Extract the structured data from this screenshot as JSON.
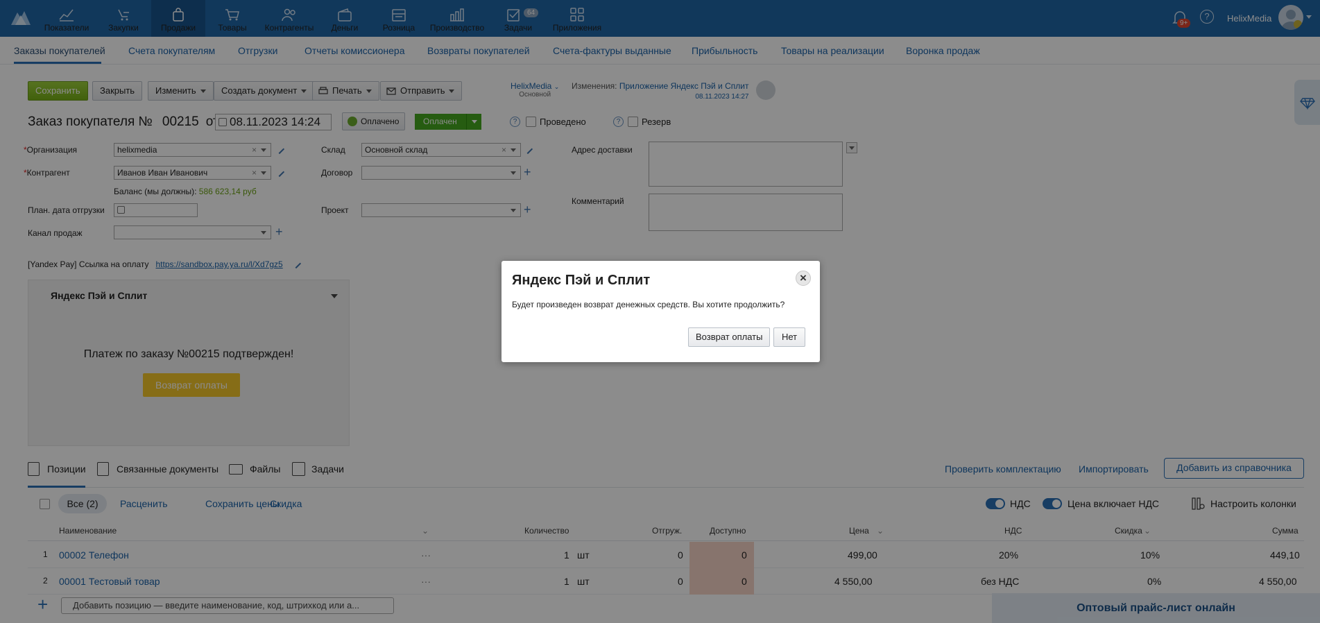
{
  "nav": {
    "items": [
      {
        "label": "Показатели",
        "icon": "chart-line-icon"
      },
      {
        "label": "Закупки",
        "icon": "purchase-icon"
      },
      {
        "label": "Продажи",
        "icon": "bag-icon"
      },
      {
        "label": "Товары",
        "icon": "cart-icon"
      },
      {
        "label": "Контрагенты",
        "icon": "people-icon"
      },
      {
        "label": "Деньги",
        "icon": "wallet-icon"
      },
      {
        "label": "Розница",
        "icon": "cash-register-icon"
      },
      {
        "label": "Производство",
        "icon": "factory-icon"
      },
      {
        "label": "Задачи",
        "icon": "tasks-icon"
      },
      {
        "label": "Приложения",
        "icon": "apps-icon"
      }
    ],
    "tasks_badge": "64",
    "notifications_badge": "9+",
    "username": "HelixMedia",
    "help_label": "?"
  },
  "subnav": {
    "items": [
      "Заказы покупателей",
      "Счета покупателям",
      "Отгрузки",
      "Отчеты комиссионера",
      "Возвраты покупателей",
      "Счета-фактуры выданные",
      "Прибыльность",
      "Товары на реализации",
      "Воронка продаж"
    ]
  },
  "toolbar": {
    "save": "Сохранить",
    "close": "Закрыть",
    "edit": "Изменить",
    "create_doc": "Создать документ",
    "print": "Печать",
    "send": "Отправить",
    "org_name": "HelixMedia",
    "org_sub": "Основной",
    "changes_label": "Изменения:",
    "changes_author": "Приложение Яндекс Пэй и Сплит",
    "changes_date": "08.11.2023 14:27"
  },
  "order": {
    "title": "Заказ покупателя №",
    "number": "00215",
    "from": "от",
    "date": "08.11.2023 14:24",
    "paid_button": "Оплачено",
    "status": "Оплачен",
    "posted_label": "Проведено",
    "reserve_label": "Резерв",
    "question": "?"
  },
  "fields": {
    "org_label": "Организация",
    "org_value": "helixmedia",
    "contractor_label": "Контрагент",
    "contractor_value": "Иванов Иван Иванович",
    "balance_label": "Баланс (мы должны):",
    "balance_value": "586 623,14 руб",
    "ship_date_label": "План. дата отгрузки",
    "channel_label": "Канал продаж",
    "warehouse_label": "Склад",
    "warehouse_value": "Основной склад",
    "contract_label": "Договор",
    "project_label": "Проект",
    "address_label": "Адрес доставки",
    "comment_label": "Комментарий",
    "required_mark": "*",
    "clear_mark": "×"
  },
  "yandex": {
    "link_label": "[Yandex Pay] Ссылка на оплату",
    "link_url": "https://sandbox.pay.ya.ru/l/Xd7gz5",
    "panel_title": "Яндекс Пэй и Сплит",
    "panel_message": "Платеж по заказу №00215 подтвержден!",
    "refund_button": "Возврат оплаты"
  },
  "tabs": {
    "positions": "Позиции",
    "related": "Связанные документы",
    "files": "Файлы",
    "tasks": "Задачи",
    "check": "Проверить комплектацию",
    "import": "Импортировать",
    "add_ref": "Добавить из справочника"
  },
  "filters": {
    "all": "Все (2)",
    "price": "Расценить",
    "save_prices": "Сохранить цены",
    "discount": "Скидка",
    "vat": "НДС",
    "price_incl_vat": "Цена включает НДС",
    "columns": "Настроить колонки"
  },
  "table": {
    "headers": {
      "name": "Наименование",
      "qty": "Количество",
      "shipped": "Отгруж.",
      "available": "Доступно",
      "price": "Цена",
      "vat": "НДС",
      "discount": "Скидка",
      "sum": "Сумма"
    },
    "rows": [
      {
        "n": "1",
        "name": "00002 Телефон",
        "more": "···",
        "qty": "1",
        "unit": "шт",
        "shipped": "0",
        "available": "0",
        "price": "499,00",
        "vat": "20%",
        "discount": "10%",
        "sum": "449,10"
      },
      {
        "n": "2",
        "name": "00001 Тестовый товар",
        "more": "···",
        "qty": "1",
        "unit": "шт",
        "shipped": "0",
        "available": "0",
        "price": "4 550,00",
        "vat": "без НДС",
        "discount": "0%",
        "sum": "4 550,00"
      }
    ],
    "add_placeholder": "Добавить позицию — введите наименование, код, штрихкод или а...",
    "add_plus": "+"
  },
  "price_list": "Оптовый прайс-лист онлайн",
  "modal": {
    "title": "Яндекс Пэй и Сплит",
    "close": "×",
    "body": "Будет произведен возврат денежных средств. Вы хотите продолжить?",
    "confirm": "Возврат оплаты",
    "cancel": "Нет"
  }
}
